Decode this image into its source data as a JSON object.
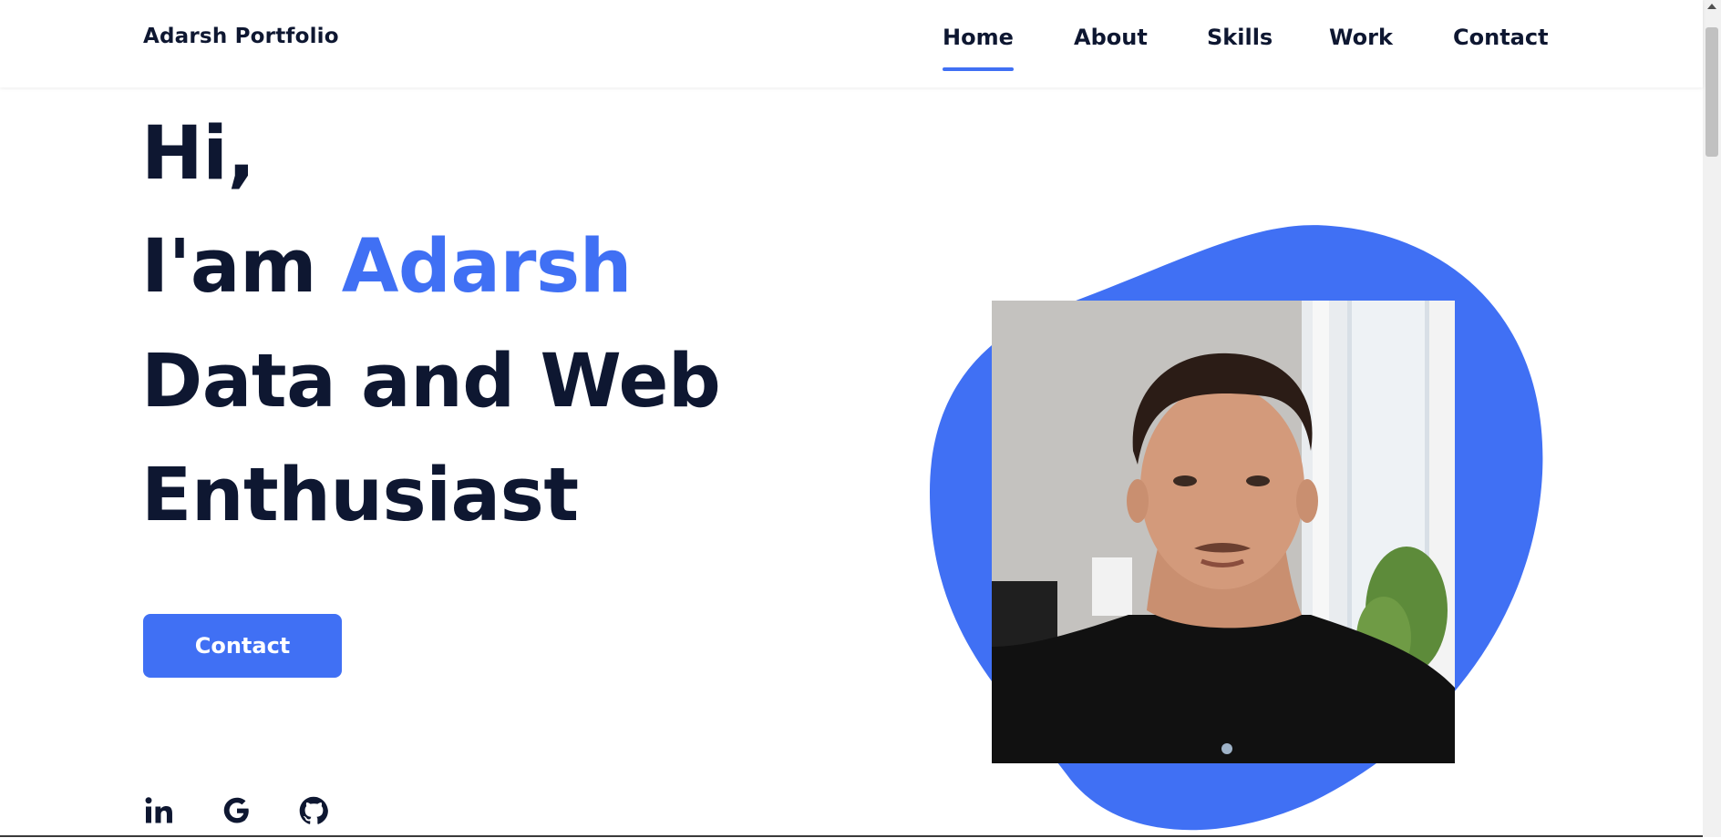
{
  "header": {
    "brand": "Adarsh Portfolio",
    "nav": [
      "Home",
      "About",
      "Skills",
      "Work",
      "Contact"
    ],
    "active_nav": "Home"
  },
  "hero": {
    "line1": "Hi,",
    "line2_prefix": "I'am ",
    "line2_name": "Adarsh",
    "line3": "Data and Web",
    "line4": "Enthusiast",
    "button": "Contact"
  },
  "social": [
    "linkedin-icon",
    "google-icon",
    "github-icon"
  ],
  "colors": {
    "accent": "#4070f4",
    "text": "#0e1731",
    "background": "#ffffff"
  }
}
